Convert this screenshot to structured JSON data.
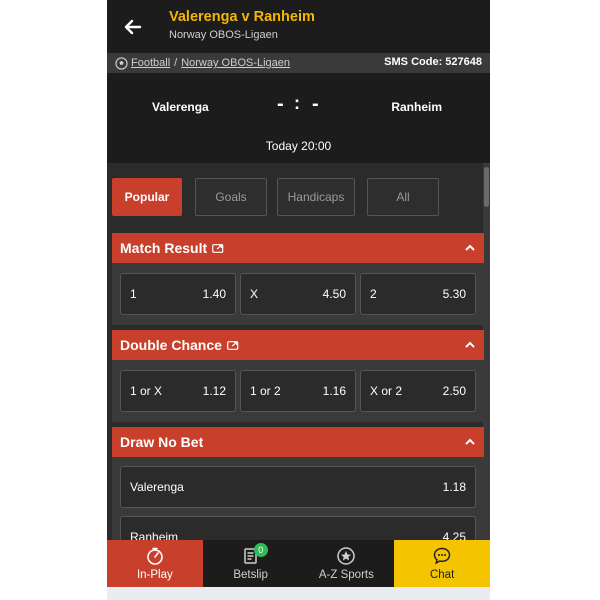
{
  "header": {
    "title": "Valerenga v Ranheim",
    "subtitle": "Norway OBOS-Ligaen"
  },
  "breadcrumb": {
    "items": [
      "Football",
      "Norway OBOS-Ligaen"
    ],
    "separator": "/",
    "sms_code": "SMS Code: 527648"
  },
  "match": {
    "home": "Valerenga",
    "away": "Ranheim",
    "home_score": "-",
    "away_score": "-",
    "score_separator": ":",
    "time": "Today 20:00"
  },
  "tabs": [
    "Popular",
    "Goals",
    "Handicaps",
    "All"
  ],
  "active_tab": "Popular",
  "markets": [
    {
      "title": "Match Result",
      "has_external_icon": true,
      "odds": [
        {
          "label": "1",
          "price": "1.40"
        },
        {
          "label": "X",
          "price": "4.50"
        },
        {
          "label": "2",
          "price": "5.30"
        }
      ]
    },
    {
      "title": "Double Chance",
      "has_external_icon": true,
      "odds": [
        {
          "label": "1 or X",
          "price": "1.12"
        },
        {
          "label": "1 or 2",
          "price": "1.16"
        },
        {
          "label": "X or 2",
          "price": "2.50"
        }
      ]
    },
    {
      "title": "Draw No Bet",
      "has_external_icon": false,
      "odds": [
        {
          "label": "Valerenga",
          "price": "1.18"
        },
        {
          "label": "Ranheim",
          "price": "4.25"
        }
      ]
    }
  ],
  "bottom_nav": {
    "inplay": "In-Play",
    "betslip": "Betslip",
    "betslip_count": "0",
    "azsports": "A-Z Sports",
    "chat": "Chat"
  },
  "colors": {
    "accent_red": "#c8402b",
    "title_yellow": "#f2b705",
    "chat_yellow": "#f5c400",
    "badge_green": "#2ebd59",
    "panel_dark": "#2b2b2b"
  },
  "icons": {
    "back": "arrow-left-icon",
    "sport": "football-icon",
    "external": "external-link-icon",
    "collapse": "chevron-up-icon",
    "inplay": "stopwatch-icon",
    "betslip": "betslip-icon",
    "azsports": "star-badge-icon",
    "chat": "chat-bubble-icon"
  }
}
